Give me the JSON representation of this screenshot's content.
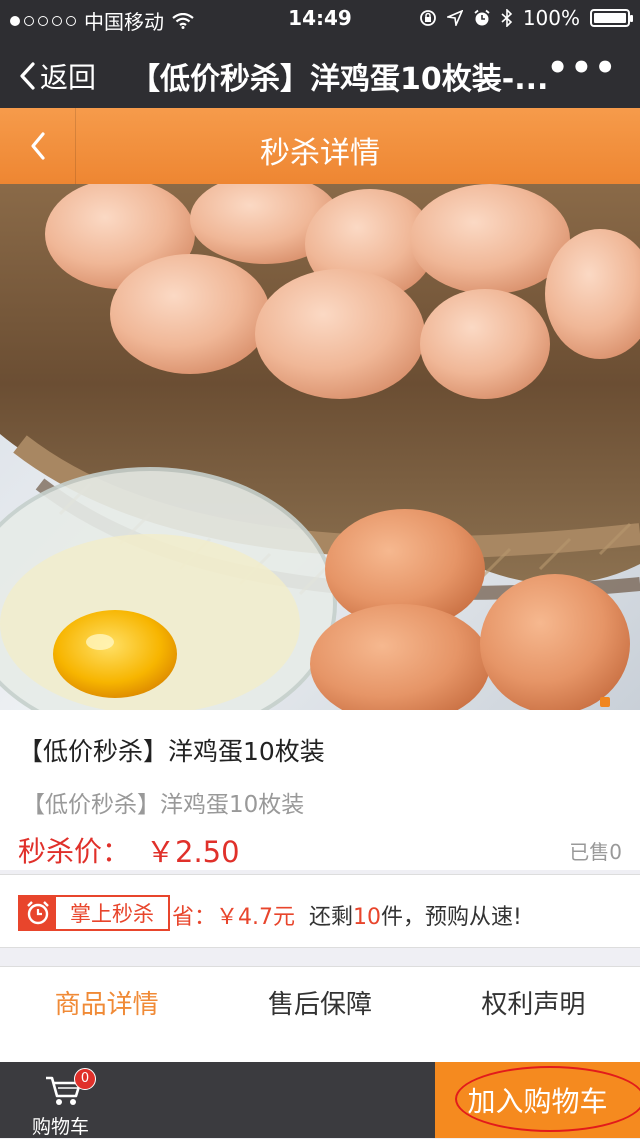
{
  "status_bar": {
    "carrier": "中国移动",
    "time": "14:49",
    "battery": "100%",
    "signal_icon": "signal-dots-icon",
    "wifi_icon": "wifi-icon"
  },
  "nav_bar": {
    "back_label": "返回",
    "title": "【低价秒杀】洋鸡蛋10枚装-...",
    "more_label": "•••"
  },
  "header": {
    "title": "秒杀详情"
  },
  "product": {
    "name": "【低价秒杀】洋鸡蛋10枚装",
    "subtitle": "【低价秒杀】洋鸡蛋10枚装",
    "price_label": "秒杀价：",
    "price": "￥2.50",
    "sold": "已售0"
  },
  "promo": {
    "badge_text": "掌上秒杀",
    "save_label": "省：",
    "save_amount": "￥4.7元",
    "remain_prefix": "还剩",
    "remain_count": "10",
    "remain_suffix": "件，预购从速!"
  },
  "tabs": [
    {
      "label": "商品详情",
      "active": true
    },
    {
      "label": "售后保障",
      "active": false
    },
    {
      "label": "权利声明",
      "active": false
    }
  ],
  "bottom_bar": {
    "cart_label": "购物车",
    "cart_count": "0",
    "add_to_cart_label": "加入购物车"
  },
  "colors": {
    "accent": "#f08a36",
    "price_red": "#e0302a",
    "dark_bar": "#2e2e32"
  }
}
